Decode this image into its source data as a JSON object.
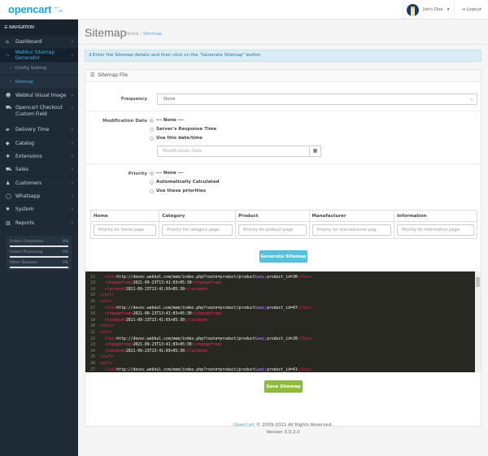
{
  "header": {
    "logo": "opencart",
    "user_name": "John Doe",
    "logout": "Logout"
  },
  "sidebar": {
    "title": "NAVIGATION",
    "items": [
      {
        "label": "Dashboard",
        "icon": "dashboard-icon"
      },
      {
        "label": "Webkul Sitemap Generator",
        "icon": "sitemap-icon",
        "active": true
      },
      {
        "label": "Config Setting",
        "sub": true
      },
      {
        "label": "Sitemap",
        "sub": true,
        "current": true
      },
      {
        "label": "Webkul Visual Image",
        "icon": "users-icon"
      },
      {
        "label": "Opencart Checkout Custom Field",
        "icon": "cart-icon"
      },
      {
        "label": "Delivery Time",
        "icon": "truck-icon"
      },
      {
        "label": "Catalog",
        "icon": "tags-icon"
      },
      {
        "label": "Extensions",
        "icon": "puzzle-icon"
      },
      {
        "label": "Sales",
        "icon": "cart-icon"
      },
      {
        "label": "Customers",
        "icon": "user-icon"
      },
      {
        "label": "Whatsapp",
        "icon": "whatsapp-icon"
      },
      {
        "label": "System",
        "icon": "gear-icon"
      },
      {
        "label": "Reports",
        "icon": "bar-chart-icon"
      }
    ],
    "stats": [
      {
        "label": "Orders Completed",
        "value": "0%"
      },
      {
        "label": "Orders Processing",
        "value": "0%"
      },
      {
        "label": "Other Statuses",
        "value": "0%"
      }
    ]
  },
  "page": {
    "title": "Sitemap",
    "breadcrumb": [
      "Home",
      "Sitemap"
    ],
    "alert": "Enter the Sitemap details and then click on the \"Generate Sitemap\" button",
    "panel_title": "Sitemap File",
    "frequency": {
      "label": "Frequency",
      "value": "None"
    },
    "modification": {
      "label": "Modification Date",
      "options": [
        "--- None ---",
        "Server's Response Time",
        "Use this date/time"
      ],
      "selected": 0,
      "placeholder": "Modification Date"
    },
    "priority": {
      "label": "Priority",
      "options": [
        "--- None ---",
        "Automatically Calculated",
        "Use these priorities"
      ],
      "selected": 0
    },
    "priority_table": {
      "headers": [
        "Home",
        "Category",
        "Product",
        "Manufacturer",
        "Information"
      ],
      "placeholders": [
        "Priority for home page",
        "Priority for category page",
        "Priority for product page",
        "Priority for manufacturer pag",
        "Priority for information page"
      ]
    },
    "generate_label": "Generate Sitemap",
    "save_label": "Save Sitemap"
  },
  "code_lines": [
    {
      "n": 11,
      "text": "<url>"
    },
    {
      "n": 12,
      "text": "  <loc>http://devoc.webkul.com/mem/index.php?route=product/product&amp;product_id=30</loc>"
    },
    {
      "n": 13,
      "text": "  <changefreq>2021-09-23T13:41:03+05:30</changefreq>"
    },
    {
      "n": 14,
      "text": "  <lastmod>2021-09-23T13:41:03+05:30</lastmod>"
    },
    {
      "n": 15,
      "text": "</url>"
    },
    {
      "n": 16,
      "text": "<url>"
    },
    {
      "n": 17,
      "text": "  <loc>http://devoc.webkul.com/mem/index.php?route=product/product&amp;product_id=47</loc>"
    },
    {
      "n": 18,
      "text": "  <changefreq>2021-09-23T13:41:03+05:30</changefreq>"
    },
    {
      "n": 19,
      "text": "  <lastmod>2021-09-23T13:41:03+05:30</lastmod>"
    },
    {
      "n": 20,
      "text": "</url>"
    },
    {
      "n": 21,
      "text": "<url>"
    },
    {
      "n": 22,
      "text": "  <loc>http://devoc.webkul.com/mem/index.php?route=product/product&amp;product_id=28</loc>"
    },
    {
      "n": 23,
      "text": "  <changefreq>2021-09-23T13:41:03+05:30</changefreq>"
    },
    {
      "n": 24,
      "text": "  <lastmod>2021-09-23T13:41:03+05:30</lastmod>"
    },
    {
      "n": 25,
      "text": "</url>"
    },
    {
      "n": 26,
      "text": "<url>"
    },
    {
      "n": 27,
      "text": "  <loc>http://devoc.webkul.com/mem/index.php?route=product/product&amp;product_id=41</loc>"
    }
  ],
  "footer": {
    "brand": "OpenCart",
    "copyright": " © 2009-2021 All Rights Reserved.",
    "version": "Version 3.0.2.0"
  },
  "colors": {
    "accent": "#23a1d1",
    "sidebar": "#1e2b37",
    "info": "#5bc0de",
    "success": "#8fbb41",
    "editor": "#272822"
  }
}
